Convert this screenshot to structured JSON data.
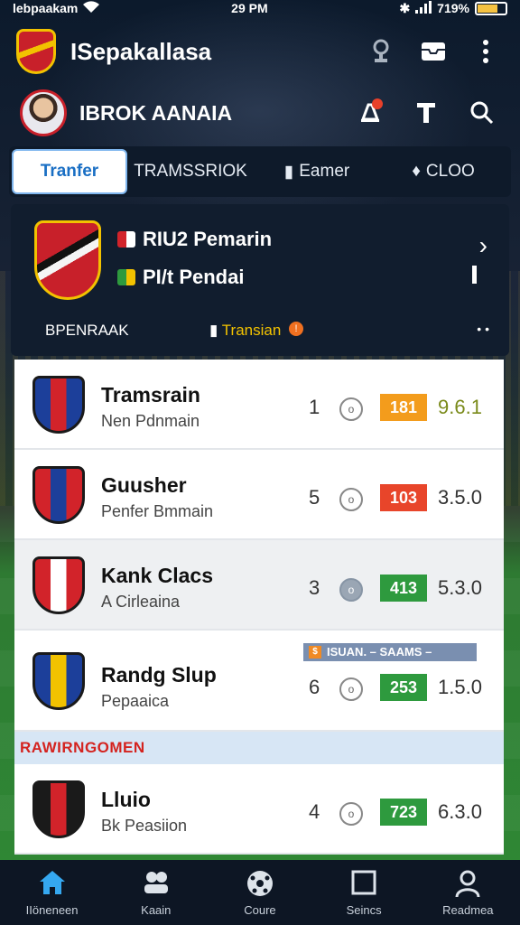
{
  "status_bar": {
    "carrier": "lebpaakam",
    "time": "29 PM",
    "battery": "719%"
  },
  "app_bar": {
    "title": "ISepakallasa"
  },
  "profile": {
    "name": "IBROK AANAIA"
  },
  "tabs": [
    {
      "label": "Tranfer",
      "active": true
    },
    {
      "label": "TRAMSSRIOK",
      "active": false
    },
    {
      "label": "Eamer",
      "active": false
    },
    {
      "label": "CLOO",
      "active": false
    }
  ],
  "match": {
    "line1": "RIU2 Pemarin",
    "line2": "PI/t Pendai",
    "sub_left": "BPENRAAK",
    "sub_center": "Transian",
    "live_badge": "!",
    "more": "• •"
  },
  "clubs": [
    {
      "name": "Tramsrain",
      "sub": "Nen Pdnmain",
      "pos": "1",
      "score": "181",
      "score_color": "#f39c1c",
      "value": "9.6.1",
      "value_color": "#7a8a1a",
      "crest_colors": [
        "#1c3f9a",
        "#d2232a"
      ],
      "grey": false
    },
    {
      "name": "Guusher",
      "sub": "Penfer Bmmain",
      "pos": "5",
      "score": "103",
      "score_color": "#e8452a",
      "value": "3.5.0",
      "value_color": "#333",
      "crest_colors": [
        "#d2232a",
        "#1c3f9a"
      ],
      "grey": false
    },
    {
      "name": "Kank Clacs",
      "sub": "A Cirleaina",
      "pos": "3",
      "score": "413",
      "score_color": "#2e9a3e",
      "value": "5.3.0",
      "value_color": "#333",
      "crest_colors": [
        "#d2232a",
        "#ffffff"
      ],
      "grey": true
    },
    {
      "name": "Randg Slup",
      "sub": "Pepaaica",
      "pos": "6",
      "score": "253",
      "score_color": "#2e9a3e",
      "value": "1.5.0",
      "value_color": "#333",
      "crest_colors": [
        "#1c3f9a",
        "#f2c200"
      ],
      "grey": false,
      "ribbon": "ISUAN. – SAAMS –"
    },
    {
      "name": "Lluio",
      "sub": "Bk Peasiion",
      "pos": "4",
      "score": "723",
      "score_color": "#2e9a3e",
      "value": "6.3.0",
      "value_color": "#333",
      "crest_colors": [
        "#1a1a1a",
        "#d2232a"
      ],
      "grey": false
    }
  ],
  "section_label": "RAWIRNGOMEN",
  "bottom_nav": [
    {
      "label": "IIöneneen",
      "icon": "home-icon",
      "active": true
    },
    {
      "label": "Kaain",
      "icon": "people-icon",
      "active": false
    },
    {
      "label": "Coure",
      "icon": "ball-icon",
      "active": false
    },
    {
      "label": "Seincs",
      "icon": "square-icon",
      "active": false
    },
    {
      "label": "Readmea",
      "icon": "person-icon",
      "active": false
    }
  ]
}
